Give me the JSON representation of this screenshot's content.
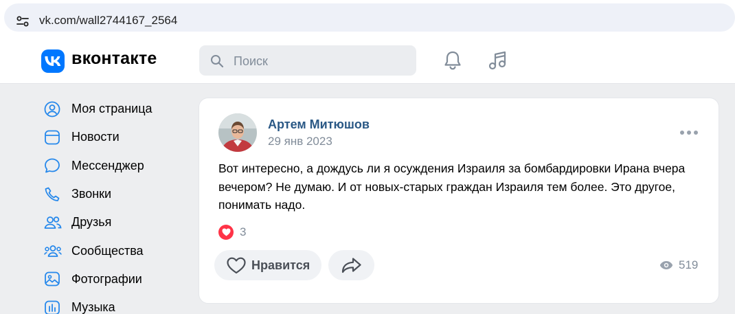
{
  "browser": {
    "url": "vk.com/wall2744167_2564"
  },
  "header": {
    "logo_text": "вконтакте",
    "search_placeholder": "Поиск",
    "icons": [
      "bell-icon",
      "music-icon"
    ]
  },
  "sidebar": {
    "items": [
      {
        "label": "Моя страница",
        "icon": "user-circle-icon"
      },
      {
        "label": "Новости",
        "icon": "news-icon"
      },
      {
        "label": "Мессенджер",
        "icon": "message-icon"
      },
      {
        "label": "Звонки",
        "icon": "phone-icon"
      },
      {
        "label": "Друзья",
        "icon": "friends-icon"
      },
      {
        "label": "Сообщества",
        "icon": "communities-icon"
      },
      {
        "label": "Фотографии",
        "icon": "photo-icon"
      },
      {
        "label": "Музыка",
        "icon": "music-chart-icon"
      }
    ]
  },
  "post": {
    "author": "Артем Митюшов",
    "date": "29 янв 2023",
    "text": "Вот интересно, а дождусь ли я осуждения Израиля за бомбардировки Ирана вчера вечером? Не думаю. И от новых-старых граждан Израиля тем более. Это другое, понимать надо.",
    "reaction_count": "3",
    "like_label": "Нравится",
    "views": "519"
  },
  "colors": {
    "vk_blue": "#0077ff",
    "author_link": "#2a5885",
    "reaction_red": "#ff3347",
    "page_bg": "#edeef0"
  }
}
